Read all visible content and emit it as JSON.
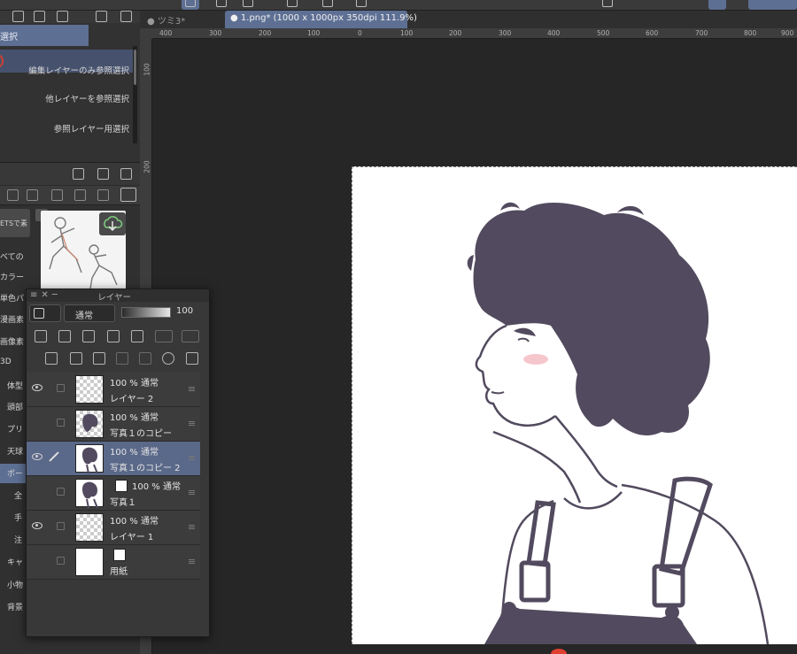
{
  "top_toolbar": {
    "icons": [
      "menu-icon",
      "select-tool-icon",
      "diamond-icon",
      "transform-icon",
      "layer-add-icon",
      "undo-icon",
      "redo-icon"
    ]
  },
  "left_panel": {
    "header": "選択",
    "options": [
      "編集レイヤーのみ参照選択",
      "他レイヤーを参照選択",
      "参照レイヤー用選択"
    ]
  },
  "materials": {
    "assets_label": "ETSで素",
    "items": [
      "べての",
      "カラー",
      "単色パ",
      "漫画素",
      "画像素",
      "3D",
      "体型",
      "頭部",
      "プリ",
      "天球",
      "ポー",
      "全",
      "手",
      "注",
      "キャ",
      "小物",
      "背景"
    ]
  },
  "canvas": {
    "tabs": [
      "ツミ3*",
      "1.png* (1000 x 1000px 350dpi 111.9%)"
    ],
    "ruler_top": [
      "400",
      "300",
      "200",
      "100",
      "0",
      "100",
      "200",
      "300",
      "400",
      "500",
      "600",
      "700",
      "800",
      "900"
    ],
    "ruler_left": [
      "100",
      "200"
    ]
  },
  "layer_panel": {
    "title": "レイヤー",
    "blend_mode": "通常",
    "opacity": "100",
    "layers": [
      {
        "percent": "100 %",
        "mode": "通常",
        "name": "レイヤー 2",
        "visible": true,
        "thumb": "checker"
      },
      {
        "percent": "100 %",
        "mode": "通常",
        "name": "写真１のコピー",
        "visible": false,
        "thumb": "figure"
      },
      {
        "percent": "100 %",
        "mode": "通常",
        "name": "写真１のコピー 2",
        "visible": true,
        "thumb": "figure",
        "active": true
      },
      {
        "percent": "100 %",
        "mode": "通常",
        "name": "写真１",
        "visible": false,
        "thumb": "figure"
      },
      {
        "percent": "100 %",
        "mode": "通常",
        "name": "レイヤー 1",
        "visible": true,
        "thumb": "checker"
      },
      {
        "name": "用紙",
        "visible": false,
        "thumb": "white"
      }
    ]
  },
  "colors": {
    "accent": "#5d6f93",
    "ink": "#524a5e",
    "blush": "#f4b8c0"
  }
}
